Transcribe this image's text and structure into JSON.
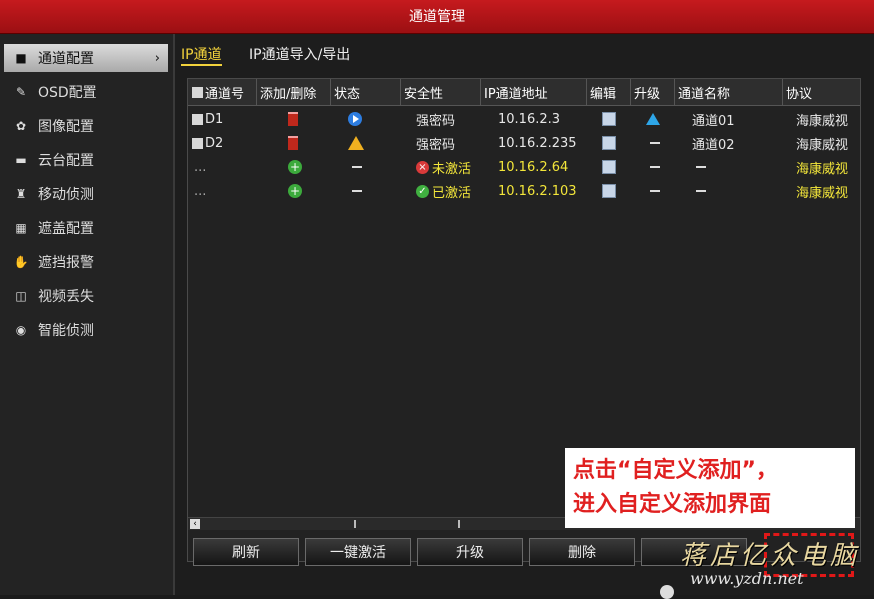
{
  "window": {
    "title": "通道管理"
  },
  "sidebar": {
    "items": [
      {
        "label": "通道配置",
        "icon": "camera-icon",
        "active": true
      },
      {
        "label": "OSD配置",
        "icon": "osd-icon"
      },
      {
        "label": "图像配置",
        "icon": "image-icon"
      },
      {
        "label": "云台配置",
        "icon": "ptz-icon"
      },
      {
        "label": "移动侦测",
        "icon": "motion-icon"
      },
      {
        "label": "遮盖配置",
        "icon": "mask-icon"
      },
      {
        "label": "遮挡报警",
        "icon": "hand-icon"
      },
      {
        "label": "视频丢失",
        "icon": "video-lost-icon"
      },
      {
        "label": "智能侦测",
        "icon": "smart-icon"
      }
    ],
    "arrow": "›"
  },
  "tabs": [
    {
      "label": "IP通道",
      "active": true
    },
    {
      "label": "IP通道导入/导出"
    }
  ],
  "table": {
    "headers": [
      "通道号",
      "添加/删除",
      "状态",
      "安全性",
      "IP通道地址",
      "编辑",
      "升级",
      "通道名称",
      "协议"
    ],
    "rows": [
      {
        "channel": "D1",
        "security": "强密码",
        "ip": "10.16.2.3",
        "name": "通道01",
        "protocol": "海康威视"
      },
      {
        "channel": "D2",
        "security": "强密码",
        "ip": "10.16.2.235",
        "name": "通道02",
        "protocol": "海康威视"
      },
      {
        "channel": "...",
        "security": "未激活",
        "ip": "10.16.2.64",
        "name": "",
        "protocol": "海康威视"
      },
      {
        "channel": "...",
        "security": "已激活",
        "ip": "10.16.2.103",
        "name": "",
        "protocol": "海康威视"
      }
    ]
  },
  "buttons": {
    "refresh": "刷新",
    "activate_all": "一键激活",
    "upgrade": "升级",
    "delete": "删除",
    "partial": "一"
  },
  "callout": {
    "line1": "点击“自定义添加”，",
    "line2": "进入自定义添加界面"
  },
  "watermark": {
    "text": "蒋店亿众电脑",
    "url": "www.yzdn.net"
  },
  "colors": {
    "accent_red": "#c61a1e",
    "highlight_yellow": "#f3e63a",
    "tab_active": "#f2d23c"
  }
}
